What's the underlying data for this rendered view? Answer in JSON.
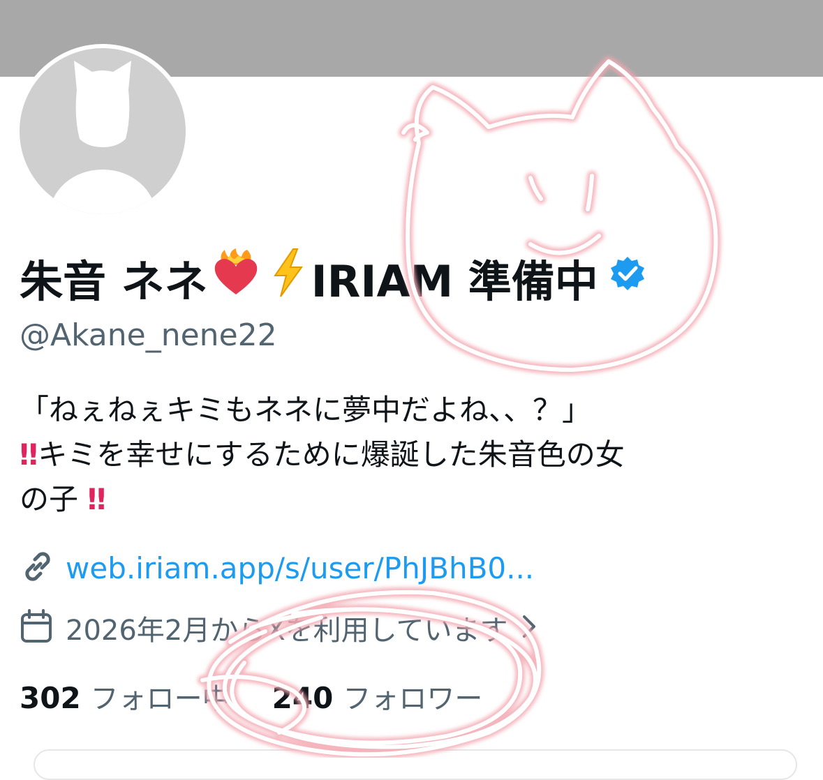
{
  "profile": {
    "display_name_prefix": "朱音 ネネ",
    "display_name_suffix": "IRIAM 準備中",
    "handle": "@Akane_nene22",
    "verified": true,
    "heart_icon": "heart-on-fire-icon",
    "bolt_icon": "high-voltage-icon"
  },
  "bio": {
    "line1": "「ねぇねぇキミもネネに夢中だよね、、？」",
    "line2_mark": "‼",
    "line2_text": "キミを幸せにするために爆誕した朱音色の女",
    "line3_text": "の子",
    "line3_mark": "‼"
  },
  "link": {
    "text": "web.iriam.app/s/user/PhJBhB0..."
  },
  "joined": {
    "text": "2026年2月からXを利用しています"
  },
  "stats": {
    "following_count": "302",
    "following_label": "フォロー中",
    "followers_count": "240",
    "followers_label": "フォロワー"
  },
  "colors": {
    "banner": "#a8a8a8",
    "avatar_bg": "#cfcfcf",
    "link": "#1d9bf0",
    "secondary_text": "#536471",
    "verified_badge": "#1d9bf0",
    "scribble": "#f0a0a8"
  }
}
